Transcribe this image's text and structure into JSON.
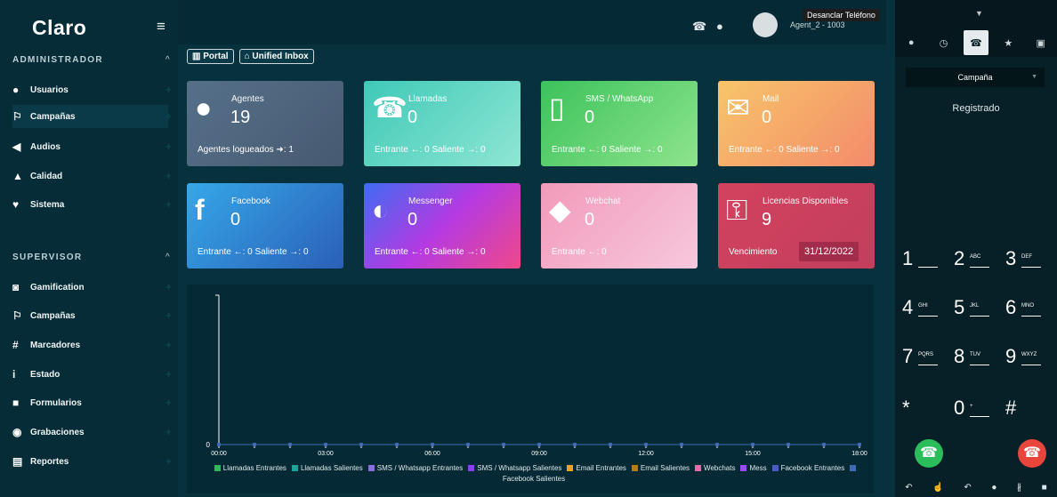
{
  "brand": {
    "logo": "Claro"
  },
  "sidebar": {
    "admin_header": "ADMINISTRADOR",
    "admin_items": [
      {
        "label": "Usuarios",
        "icon": "user-icon"
      },
      {
        "label": "Campañas",
        "icon": "flag-icon"
      },
      {
        "label": "Audios",
        "icon": "volume-icon"
      },
      {
        "label": "Calidad",
        "icon": "thumbs-up-icon"
      },
      {
        "label": "Sistema",
        "icon": "heartbeat-icon"
      }
    ],
    "supervisor_header": "SUPERVISOR",
    "supervisor_items": [
      {
        "label": "Gamification",
        "icon": "gamepad-icon"
      },
      {
        "label": "Campañas",
        "icon": "flag-icon"
      },
      {
        "label": "Marcadores",
        "icon": "hashtag-icon"
      },
      {
        "label": "Estado",
        "icon": "info-icon"
      },
      {
        "label": "Formularios",
        "icon": "folder-icon"
      },
      {
        "label": "Grabaciones",
        "icon": "play-circle-icon"
      },
      {
        "label": "Reportes",
        "icon": "file-icon"
      }
    ]
  },
  "topbar": {
    "agent": "Agent_2 - 1003",
    "tooltip": "Desanclar Teléfono"
  },
  "tabs": [
    "Portal",
    "Unified Inbox"
  ],
  "cards": [
    {
      "title": "Agentes",
      "value": "19",
      "footer": "Agentes logueados ➜: 1",
      "color": "#4d6277"
    },
    {
      "title": "Llamadas",
      "value": "0",
      "footer": "Entrante ←: 0    Saliente →: 0",
      "color": "#5ed3c4"
    },
    {
      "title": "SMS / WhatsApp",
      "value": "0",
      "footer": "Entrante ←: 0    Saliente →: 0",
      "color": "#4cc96a"
    },
    {
      "title": "Mail",
      "value": "0",
      "footer": "Entrante ←: 0    Saliente →: 0",
      "color": "#f6a25d"
    },
    {
      "title": "Facebook",
      "value": "0",
      "footer": "Entrante ←: 0    Saliente →: 0",
      "color": "#3b7fd8"
    },
    {
      "title": "Messenger",
      "value": "0",
      "footer": "Entrante ←: 0    Saliente →: 0",
      "color": "#a23fe0"
    },
    {
      "title": "Webchat",
      "value": "0",
      "footer": "Entrante ←: 0",
      "color": "#f0a3c4"
    },
    {
      "title": "Licencias Disponibles",
      "value": "9",
      "footer": "Vencimiento",
      "date": "31/12/2022",
      "color": "#c8415f"
    }
  ],
  "chart_data": {
    "type": "line",
    "x": [
      "00:00",
      "01:00",
      "02:00",
      "03:00",
      "04:00",
      "05:00",
      "06:00",
      "07:00",
      "08:00",
      "09:00",
      "10:00",
      "11:00",
      "12:00",
      "13:00",
      "14:00",
      "15:00",
      "16:00",
      "17:00",
      "18:00"
    ],
    "x_tick_labels": [
      "00:00",
      "03:00",
      "06:00",
      "09:00",
      "12:00",
      "15:00",
      "18:00"
    ],
    "y_tick_labels": [
      "0"
    ],
    "series": [
      {
        "name": "Llamadas Entrantes",
        "color": "#2cba59",
        "values": [
          0,
          0,
          0,
          0,
          0,
          0,
          0,
          0,
          0,
          0,
          0,
          0,
          0,
          0,
          0,
          0,
          0,
          0,
          0
        ]
      },
      {
        "name": "Llamadas Salientes",
        "color": "#1fa49a",
        "values": [
          0,
          0,
          0,
          0,
          0,
          0,
          0,
          0,
          0,
          0,
          0,
          0,
          0,
          0,
          0,
          0,
          0,
          0,
          0
        ]
      },
      {
        "name": "SMS / Whatsapp Entrantes",
        "color": "#8c6de0",
        "values": [
          0,
          0,
          0,
          0,
          0,
          0,
          0,
          0,
          0,
          0,
          0,
          0,
          0,
          0,
          0,
          0,
          0,
          0,
          0
        ]
      },
      {
        "name": "SMS / Whatsapp Salientes",
        "color": "#8c3ff0",
        "values": [
          0,
          0,
          0,
          0,
          0,
          0,
          0,
          0,
          0,
          0,
          0,
          0,
          0,
          0,
          0,
          0,
          0,
          0,
          0
        ]
      },
      {
        "name": "Email Entrantes",
        "color": "#f2a31e",
        "values": [
          0,
          0,
          0,
          0,
          0,
          0,
          0,
          0,
          0,
          0,
          0,
          0,
          0,
          0,
          0,
          0,
          0,
          0,
          0
        ]
      },
      {
        "name": "Email Salientes",
        "color": "#b87a1a",
        "values": [
          0,
          0,
          0,
          0,
          0,
          0,
          0,
          0,
          0,
          0,
          0,
          0,
          0,
          0,
          0,
          0,
          0,
          0,
          0
        ]
      },
      {
        "name": "Webchats",
        "color": "#e86aa8",
        "values": [
          0,
          0,
          0,
          0,
          0,
          0,
          0,
          0,
          0,
          0,
          0,
          0,
          0,
          0,
          0,
          0,
          0,
          0,
          0
        ]
      },
      {
        "name": "Mess",
        "color": "#9a4cf2",
        "values": [
          0,
          0,
          0,
          0,
          0,
          0,
          0,
          0,
          0,
          0,
          0,
          0,
          0,
          0,
          0,
          0,
          0,
          0,
          0
        ]
      },
      {
        "name": "Facebook Entrantes",
        "color": "#4a5bc8",
        "values": [
          0,
          0,
          0,
          0,
          0,
          0,
          0,
          0,
          0,
          0,
          0,
          0,
          0,
          0,
          0,
          0,
          0,
          0,
          0
        ]
      },
      {
        "name": "Facebook Salientes",
        "color": "#3d6bb8",
        "values": [
          0,
          0,
          0,
          0,
          0,
          0,
          0,
          0,
          0,
          0,
          0,
          0,
          0,
          0,
          0,
          0,
          0,
          0,
          0
        ]
      }
    ]
  },
  "phone": {
    "campaign": "Campaña",
    "status": "Registrado",
    "keys": [
      {
        "d": "1",
        "l": ""
      },
      {
        "d": "2",
        "l": "ABC"
      },
      {
        "d": "3",
        "l": "DEF"
      },
      {
        "d": "4",
        "l": "GHI"
      },
      {
        "d": "5",
        "l": "JKL"
      },
      {
        "d": "6",
        "l": "MNO"
      },
      {
        "d": "7",
        "l": "PQRS"
      },
      {
        "d": "8",
        "l": "TUV"
      },
      {
        "d": "9",
        "l": "WXYZ"
      },
      {
        "d": "*",
        "l": ""
      },
      {
        "d": "0",
        "l": "+"
      },
      {
        "d": "#",
        "l": ""
      }
    ],
    "call_color": "#2bbd5a",
    "hangup_color": "#e8453d"
  }
}
